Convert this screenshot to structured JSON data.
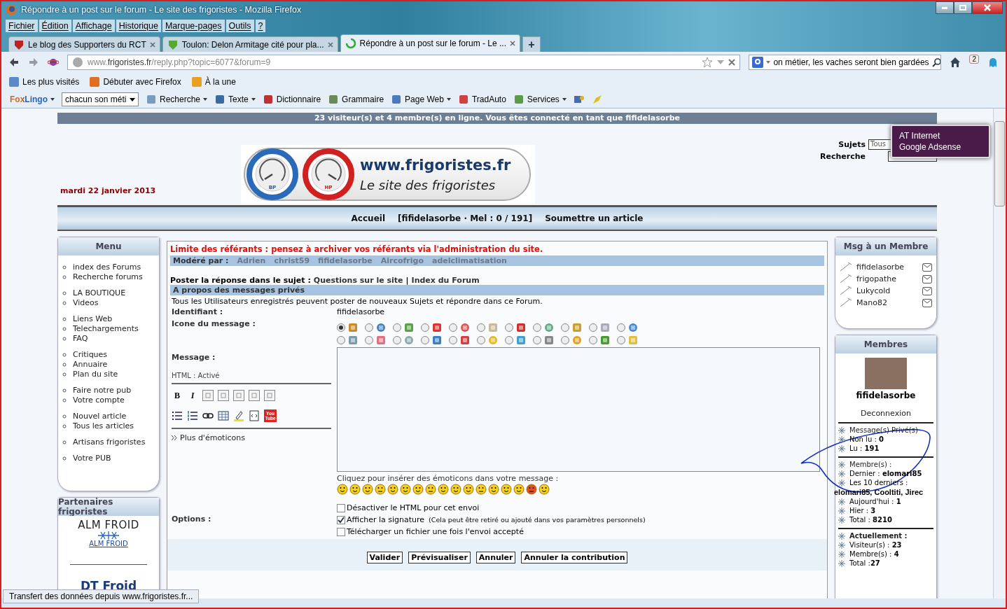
{
  "window": {
    "title": "Répondre à un post sur le forum - Le site des frigoristes - Mozilla Firefox"
  },
  "menu_bar": [
    "Fichier",
    "Édition",
    "Affichage",
    "Historique",
    "Marque-pages",
    "Outils",
    "?"
  ],
  "tabs": [
    {
      "label": "Le blog des Supporters du RCT",
      "selected": false
    },
    {
      "label": "Toulon: Delon Armitage cité pour pla...",
      "selected": false
    },
    {
      "label": "Répondre à un post sur le forum - Le ...",
      "selected": true
    }
  ],
  "new_tab": "+",
  "address_bar": {
    "url": "www.**frigoristes.fr**/reply.php?topic=6077&forum=9"
  },
  "search_field": {
    "value": "on métier, les vaches seront bien gardées"
  },
  "downloads_badge": "2",
  "bookmarks": [
    "Les plus visités",
    "Débuter avec Firefox",
    "À la une"
  ],
  "foxlingo": {
    "logo": "FoxLingo",
    "select": "chacun son méti",
    "items": [
      {
        "label": "Recherche",
        "dropdown": true
      },
      {
        "label": "Texte",
        "dropdown": true
      },
      {
        "label": "Dictionnaire",
        "dropdown": false
      },
      {
        "label": "Grammaire",
        "dropdown": false
      },
      {
        "label": "Page Web",
        "dropdown": true
      },
      {
        "label": "TradAuto",
        "dropdown": false
      },
      {
        "label": "Services",
        "dropdown": true
      }
    ]
  },
  "online_bar": "23 visiteur(s) et 4 membre(s) en ligne. Vous êtes connecté en tant que fifidelasorbe",
  "date": "mardi 22 janvier 2013",
  "logo": {
    "title": "www.frigoristes.fr",
    "subtitle": "Le site des frigoristes",
    "gauge_low": "BP",
    "gauge_high": "HP"
  },
  "site_search": {
    "subjects_label": "Sujets",
    "subjects_value": "Tous",
    "search_label": "Recherche"
  },
  "tooltip": [
    "AT Internet",
    "Google Adsense"
  ],
  "nav": [
    "Accueil",
    "[fifidelasorbe · Mel : 0 / 191]",
    "Soumettre un article"
  ],
  "left_menu": {
    "title": "Menu",
    "groups": [
      [
        "index des Forums",
        "Recherche forums"
      ],
      [
        "LA BOUTIQUE",
        "Videos"
      ],
      [
        "Liens Web",
        "Telechargements",
        "FAQ"
      ],
      [
        "Critiques",
        "Annuaire",
        "Plan du site"
      ],
      [
        "Faire notre pub",
        "Votre compte"
      ],
      [
        "Nouvel article",
        "Tous les articles"
      ],
      [
        "Artisans frigoristes"
      ],
      [
        "Votre PUB"
      ]
    ]
  },
  "partners": {
    "title": "Partenaires frigoristes",
    "first_logo": "ALM FROID",
    "first_link": "ALM FROID",
    "second_logo": "DT Froid"
  },
  "form": {
    "notice": "Limite des référants : pensez à archiver vos référants via l'administration du site.",
    "moderators_label": "Modéré par :",
    "moderators": [
      "Adrien",
      "christ59",
      "fifidelasorbe",
      "Aircofrigo",
      "adelclimatisation"
    ],
    "post_in_label": "Poster la réponse dans le sujet :",
    "post_in_links": [
      "Questions sur le site",
      "Index du Forum"
    ],
    "separator": "|",
    "section_title": "A propos des messages privés",
    "info": "Tous les Utilisateurs enregistrés peuvent poster de nouveaux Sujets et répondre dans ce Forum.",
    "identifier_label": "Identifiant :",
    "identifier": "fifidelasorbe",
    "icon_label": "Icone du message :",
    "message_icons": [
      {
        "selected": true
      },
      {
        "selected": false
      },
      {
        "selected": false
      },
      {
        "selected": false
      },
      {
        "selected": false
      },
      {
        "selected": false
      },
      {
        "selected": false
      },
      {
        "selected": false
      },
      {
        "selected": false
      },
      {
        "selected": false
      },
      {
        "selected": false
      },
      {
        "selected": false
      },
      {
        "selected": false
      },
      {
        "selected": false
      },
      {
        "selected": false
      },
      {
        "selected": false
      },
      {
        "selected": false
      },
      {
        "selected": false
      },
      {
        "selected": false
      },
      {
        "selected": false
      },
      {
        "selected": false
      },
      {
        "selected": false
      }
    ],
    "message_label": "Message :",
    "html_status": "HTML : Activé",
    "bold_button": "B",
    "italic_button": "I",
    "video_button": [
      "You",
      "Tube"
    ],
    "more_emoticons": "Plus d'émoticons",
    "emoticon_hint": "Cliquez pour insérer des émoticons dans votre message :",
    "options_label": "Options :",
    "options": [
      {
        "label": "Désactiver le HTML pour cet envoi",
        "checked": false
      },
      {
        "label": "Afficher la signature",
        "note": "(Cela peut être retiré ou ajouté dans vos paramètres personnels)",
        "checked": true
      },
      {
        "label": "Télécharger un fichier une fois l'envoi accepté",
        "checked": false
      }
    ],
    "buttons": [
      "Valider",
      "Prévisualiser",
      "Annuler",
      "Annuler la contribution"
    ]
  },
  "msg_member": {
    "title": "Msg à un Membre",
    "members": [
      "fifidelasorbe",
      "frigopathe",
      "Lukycold",
      "Mano82"
    ]
  },
  "members_box": {
    "title": "Membres",
    "username": "fifidelasorbe",
    "logout": "Deconnexion",
    "pm_title": "Message(s) Privé(s)",
    "pm_rows": [
      "Non lu : **0**",
      "Lu : **191**"
    ],
    "members_title": "Membre(s) :",
    "members_rows": [
      "Dernier : **elomari85**",
      "Les 10 derniers :"
    ],
    "latest": "elomari85, Cooltiti, Jirec",
    "stats_rows": [
      "Aujourd'hui : **1**",
      "Hier : **3**",
      "Total : **8210**"
    ],
    "current_title": "Actuellement :",
    "current_rows": [
      "Visiteur(s) : **23**",
      "Membre(s) : **4**",
      "Total :**27**"
    ]
  },
  "status_bar": "Transfert des données depuis www.frigoristes.fr..."
}
